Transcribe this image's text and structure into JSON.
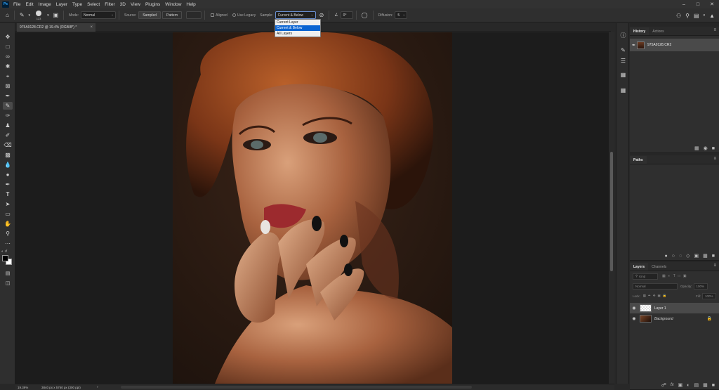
{
  "menubar": {
    "app_logo": "Ps",
    "items": [
      "File",
      "Edit",
      "Image",
      "Layer",
      "Type",
      "Select",
      "Filter",
      "3D",
      "View",
      "Plugins",
      "Window",
      "Help"
    ]
  },
  "options": {
    "brush_size": "123",
    "mode_label": "Mode:",
    "mode_value": "Normal",
    "source_label": "Source:",
    "sampled_label": "Sampled",
    "pattern_label": "Pattern",
    "aligned_label": "Aligned",
    "use_legacy_label": "Use Legacy",
    "sample_label": "Sample:",
    "sample_value": "Current & Below",
    "angle_value": "0°",
    "diffusion_label": "Diffusion:",
    "diffusion_value": "5"
  },
  "sample_menu": {
    "options": [
      "Current Layer",
      "Current & Below",
      "All Layers"
    ],
    "selected_index": 1
  },
  "document": {
    "tab_title": "975A9128.CR2 @ 19.4% (RGB/8*) *"
  },
  "status": {
    "zoom": "19.39%",
    "dimensions": "3840 px x 5760 px (300 ppi)"
  },
  "history_panel": {
    "tabs": [
      "History",
      "Actions"
    ],
    "snapshot_name": "975A9128.CR2"
  },
  "paths_panel": {
    "tab": "Paths"
  },
  "layers_panel": {
    "tabs": [
      "Layers",
      "Channels"
    ],
    "filter_placeholder": "Kind",
    "blend_mode": "Normal",
    "opacity_label": "Opacity:",
    "opacity_value": "100%",
    "lock_label": "Lock:",
    "fill_label": "Fill:",
    "fill_value": "100%",
    "layers": [
      {
        "name": "Layer 1"
      },
      {
        "name": "Background"
      }
    ]
  },
  "colors": {
    "selection": "#0a64d2",
    "panel_bg": "#2f2f2f",
    "canvas_bg": "#1c1c1c"
  }
}
